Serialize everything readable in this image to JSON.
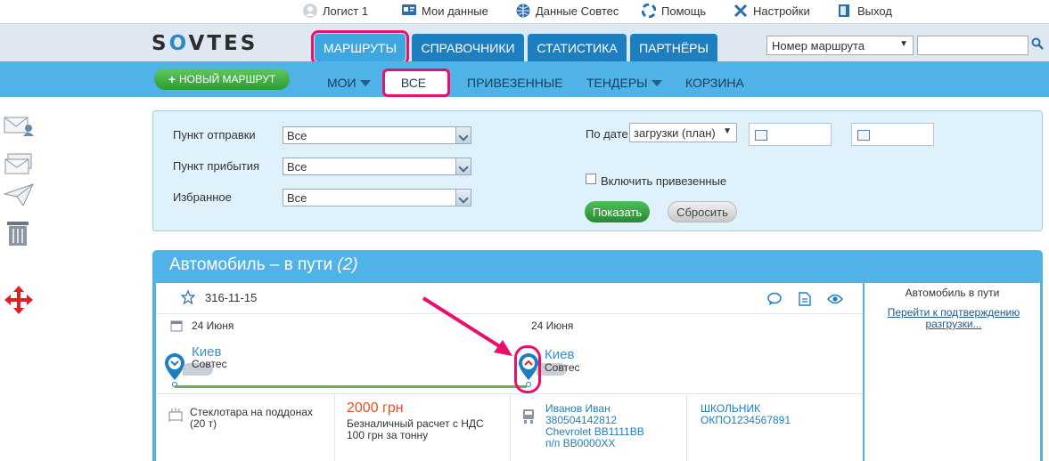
{
  "topbar": {
    "user": "Логист 1",
    "my_data": "Мои данные",
    "sovtes_data": "Данные Совтес",
    "help": "Помощь",
    "settings": "Настройки",
    "logout": "Выход"
  },
  "header": {
    "logo": "SOVTES",
    "tabs": [
      "МАРШРУТЫ",
      "СПРАВОЧНИКИ",
      "СТАТИСТИКА",
      "ПАРТНЁРЫ"
    ],
    "route_select": "Номер маршрута",
    "search_value": ""
  },
  "subnav": {
    "new_route": "НОВЫЙ МАРШРУТ",
    "items": [
      "МОИ",
      "ВСЕ",
      "ПРИВЕЗЕННЫЕ",
      "ТЕНДЕРЫ",
      "КОРЗИНА"
    ]
  },
  "filter": {
    "departure_label": "Пункт отправки",
    "departure_value": "Все",
    "arrival_label": "Пункт прибытия",
    "arrival_value": "Все",
    "favorite_label": "Избранное",
    "favorite_value": "Все",
    "by_date_label": "По дате",
    "date_type": "загрузки (план)",
    "include_delivered": "Включить привезенные",
    "show_button": "Показать",
    "reset_button": "Сбросить"
  },
  "section": {
    "title": "Автомобиль – в пути",
    "count": "(2)"
  },
  "route": {
    "number": "316-11-15",
    "from_date": "24 Июня",
    "to_date": "24 Июня",
    "from_city": "Киев",
    "from_company": "Совтес",
    "to_city": "Киев",
    "to_company": "Совтес",
    "cargo": "Стеклотара на поддонах",
    "cargo_weight": "(20 т)",
    "price": "2000 грн",
    "payment": "Безналичный расчет с НДС",
    "rate": "100 грн за тонну",
    "driver_name": "Иванов Иван",
    "driver_phone": "380504142812",
    "vehicle": "Chevrolet BB1111BB",
    "trailer": "п/п BB0000XX",
    "client_name": "ШКОЛЬНИК",
    "client_okpo": "ОКПО1234567891",
    "status": "Автомобиль в пути",
    "status_link": "Перейти к подтверждению разгрузки..."
  },
  "colors": {
    "accent": "#4fb3e8",
    "tab_blue": "#1e7fc0",
    "annotation": "#e8106a",
    "progress": "#6ab04c",
    "price": "#e0522a"
  }
}
